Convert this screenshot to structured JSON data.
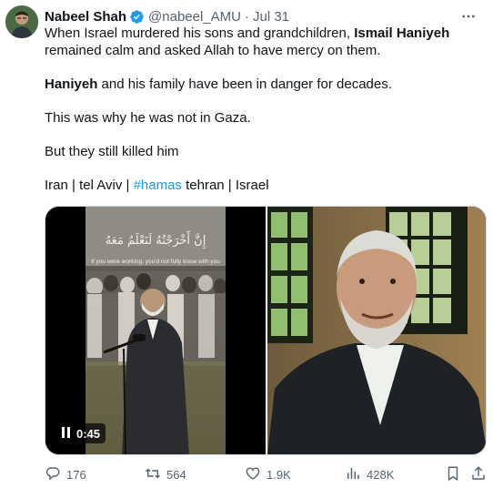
{
  "tweet": {
    "author_name": "Nabeel Shah",
    "handle": "@nabeel_AMU",
    "separator": "·",
    "date": "Jul 31",
    "paragraphs": [
      {
        "lines": [
          [
            {
              "t": "When Israel murdered his sons and grandchildren, ",
              "bold": false
            },
            {
              "t": "Ismail Haniyeh",
              "bold": true
            }
          ],
          [
            {
              "t": "remained calm and asked Allah to have mercy on them.",
              "bold": false
            }
          ]
        ]
      },
      {
        "lines": [
          [
            {
              "t": "Haniyeh",
              "bold": true
            },
            {
              "t": " and his family have been in danger for decades.",
              "bold": false
            }
          ]
        ]
      },
      {
        "lines": [
          [
            {
              "t": "This was why he was not in Gaza.",
              "bold": false
            }
          ]
        ]
      },
      {
        "lines": [
          [
            {
              "t": "But they still killed him",
              "bold": false
            }
          ]
        ]
      },
      {
        "lines": [
          [
            {
              "t": "Iran | tel Aviv | ",
              "bold": false
            },
            {
              "t": "#hamas",
              "hashtag": true
            },
            {
              "t": " tehran | Israel",
              "bold": false
            }
          ]
        ]
      }
    ]
  },
  "media": {
    "video_caption_arabic": "إِنَّ أَخْرَجْتُهُ لَنَعْلَمُ مَعَهُ",
    "video_caption_english": "If you were working, you'd not fully know with you",
    "video_duration": "0:45"
  },
  "actions": {
    "replies": "176",
    "retweets": "564",
    "likes": "1.9K",
    "views": "428K"
  },
  "colors": {
    "accent": "#1d9bf0",
    "secondary_text": "#536471",
    "verified_badge": "#1d9bf0"
  },
  "icons": [
    "verified-badge-icon",
    "more-options-icon",
    "reply-icon",
    "retweet-icon",
    "like-icon",
    "views-icon",
    "bookmark-icon",
    "share-icon",
    "pause-icon"
  ]
}
